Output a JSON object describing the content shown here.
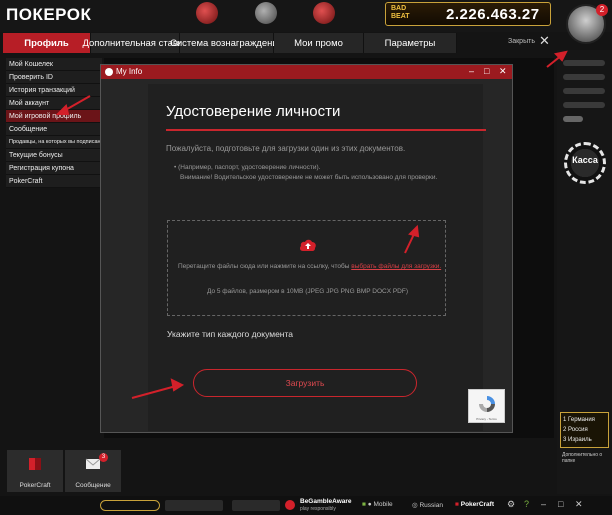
{
  "app": {
    "logo": "ПОКЕРОК"
  },
  "header": {
    "badbeat_logo_line1": "BAD",
    "badbeat_logo_line2": "BEAT",
    "badbeat_amount": "2.226.463.27",
    "avatar_badge": "2"
  },
  "tabs": [
    {
      "label": "Профиль"
    },
    {
      "label": "Дополнительная ставка"
    },
    {
      "label": "Система вознаграждений"
    },
    {
      "label": "Мои промо"
    },
    {
      "label": "Параметры"
    }
  ],
  "close_label": "Закрыть",
  "sidebar": {
    "items": [
      {
        "label": "Мой Кошелек"
      },
      {
        "label": "Проверить ID"
      },
      {
        "label": "История транзакций"
      },
      {
        "label": "Мой аккаунт"
      },
      {
        "label": "Мой игровой профиль"
      },
      {
        "label": "Сообщение"
      },
      {
        "label": "Продавцы, на которых вы подписаны"
      },
      {
        "label": "Текущие бонусы"
      },
      {
        "label": "Регистрация купона"
      },
      {
        "label": "PokerCraft"
      }
    ]
  },
  "tiles": {
    "pokercraft": "PokerCraft",
    "messages": "Сообщение",
    "messages_badge": "3"
  },
  "dialog": {
    "window_title": "My Info",
    "heading": "Удостоверение личности",
    "intro": "Пожалуйста, подготовьте для загрузки один из этих документов.",
    "note_line1": "(Например, паспорт, удостоверение личности).",
    "note_line2": "Внимание! Водительское удостоверение не может быть использовано для проверки.",
    "drop_text": "Перетащите файлы сюда или нажмите на ссылку, чтобы",
    "drop_link": "выбрать файлы для загрузки.",
    "drop_limits": "До 5 файлов, размером в 10MB (JPEG JPG PNG BMP DOCX PDF)",
    "doc_type_label": "Укажите тип каждого документа",
    "upload_button": "Загрузить",
    "recaptcha_text": "Privacy - Terms"
  },
  "rail": {
    "cashier_label": "Касса",
    "ranks": [
      {
        "num": "1",
        "label": "Германия"
      },
      {
        "num": "2",
        "label": "Россия"
      },
      {
        "num": "3",
        "label": "Израиль"
      }
    ],
    "more_label": "Дополнительно о папке"
  },
  "footer": {
    "mobile": "Mobile",
    "language": "Russian",
    "pokercraft": "PokerCraft",
    "gamble_aware_line1": "BeGambleAware",
    "gamble_aware_line2": "play responsibly"
  },
  "colors": {
    "accent": "#b71e26",
    "link": "#d94046",
    "gold": "#c9a23a"
  }
}
